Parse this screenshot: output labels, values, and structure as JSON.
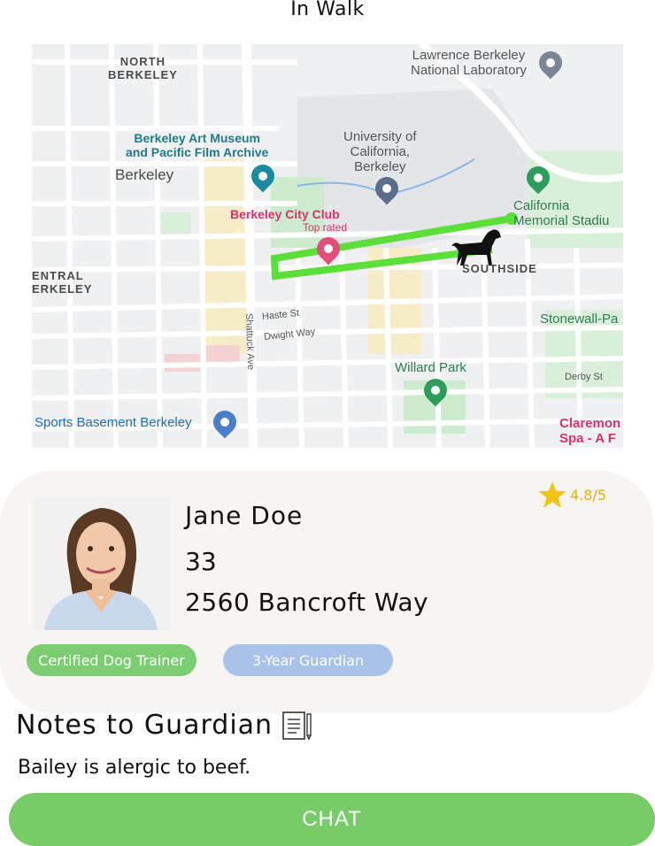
{
  "screen_title": "In Walk",
  "map": {
    "labels": {
      "north_berkeley": "NORTH\nBERKELEY",
      "lawrence": "Lawrence Berkeley\nNational Laboratory",
      "art_museum": "Berkeley Art Museum\nand Pacific Film Archive",
      "berkeley": "Berkeley",
      "university": "University of\nCalifornia,\nBerkeley",
      "memorial": "California\nMemorial Stadiu",
      "city_club": "Berkeley City Club",
      "top_rated": "Top rated",
      "central_berkeley": "ENTRAL\nERKELEY",
      "southside": "SOUTHSIDE",
      "haste": "Haste St",
      "dwight": "Dwight Way",
      "shattuck": "Shattuck Ave",
      "stonewall": "Stonewall-Pa",
      "willard": "Willard Park",
      "derby": "Derby St",
      "sports_basement": "Sports Basement Berkeley",
      "claremont": "Claremon\nSpa - A F"
    }
  },
  "profile": {
    "name": "Jane Doe",
    "age": "33",
    "address": "2560 Bancroft Way",
    "rating": "4.8/5",
    "badges": [
      "Certified Dog Trainer",
      "3-Year Guardian"
    ]
  },
  "notes": {
    "title": "Notes to Guardian",
    "text": "Bailey is alergic to beef."
  },
  "chat_button": "CHAT",
  "colors": {
    "accent_green": "#76cc66",
    "badge_blue": "#a8c2ea",
    "rating_gold": "#e2b100",
    "route_green": "#5ddf3a",
    "card_bg": "#f8f4f2"
  },
  "icons": [
    "star-icon",
    "notes-icon",
    "dog-icon",
    "museum-pin-icon",
    "university-pin-icon",
    "stadium-pin-icon",
    "lab-pin-icon",
    "club-pin-icon",
    "park-pin-icon",
    "shopping-pin-icon"
  ]
}
